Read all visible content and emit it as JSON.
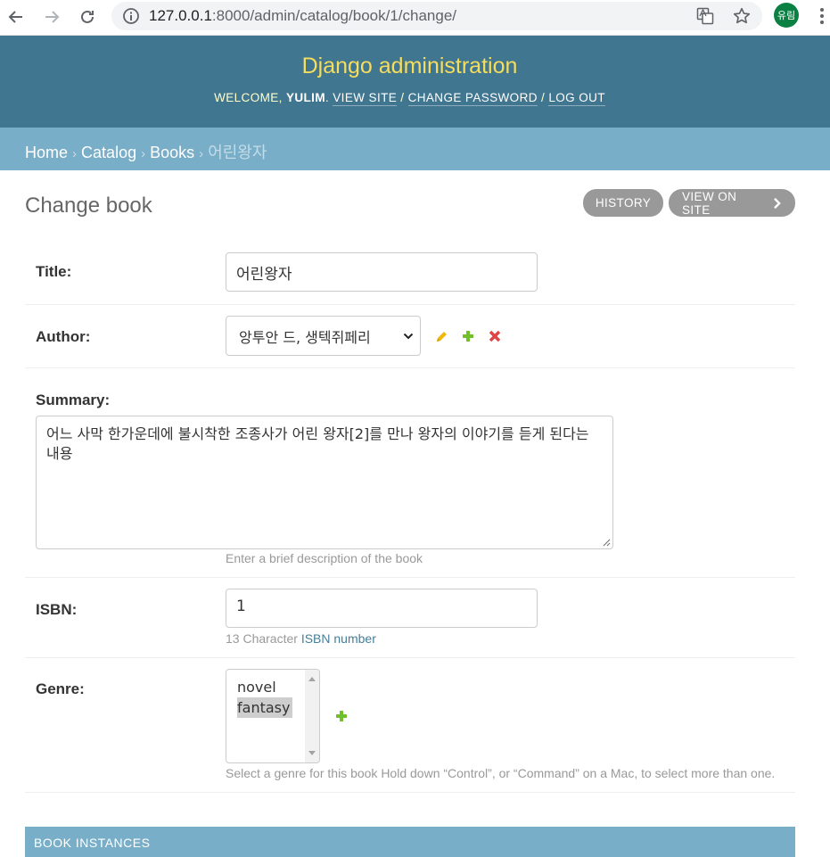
{
  "browser": {
    "url_host": "127.0.0.1",
    "url_rest": ":8000/admin/catalog/book/1/change/",
    "profile_initials": "유림"
  },
  "header": {
    "site_name": "Django administration",
    "welcome": "WELCOME,",
    "username": "YULIM",
    "view_site": "VIEW SITE",
    "change_password": "CHANGE PASSWORD",
    "log_out": "LOG OUT",
    "sep": "/"
  },
  "breadcrumbs": {
    "home": "Home",
    "catalog": "Catalog",
    "books": "Books",
    "current": "어린왕자",
    "sep": "›"
  },
  "page": {
    "title": "Change book",
    "history": "HISTORY",
    "view_on_site": "VIEW ON SITE"
  },
  "form": {
    "title_label": "Title:",
    "title_value": "어린왕자",
    "author_label": "Author:",
    "author_value": "앙투안 드, 생텍쥐페리",
    "summary_label": "Summary:",
    "summary_value": "어느 사막 한가운데에 불시착한 조종사가 어린 왕자[2]를 만나 왕자의 이야기를 듣게 된다는 내용",
    "summary_help": "Enter a brief description of the book",
    "isbn_label": "ISBN:",
    "isbn_value": "1",
    "isbn_help_prefix": "13 Character",
    "isbn_help_link": "ISBN number",
    "genre_label": "Genre:",
    "genre_options": [
      "novel",
      "fantasy"
    ],
    "genre_help": "Select a genre for this book Hold down “Control”, or “Command” on a Mac, to select more than one."
  },
  "inline": {
    "header": "BOOK INSTANCES"
  },
  "colors": {
    "header_bg": "#417690",
    "breadcrumbs_bg": "#79aec8",
    "branding": "#f5dd5d",
    "edit_icon": "#efb80b",
    "add_icon": "#70bf2b",
    "delete_icon": "#dd4646"
  }
}
